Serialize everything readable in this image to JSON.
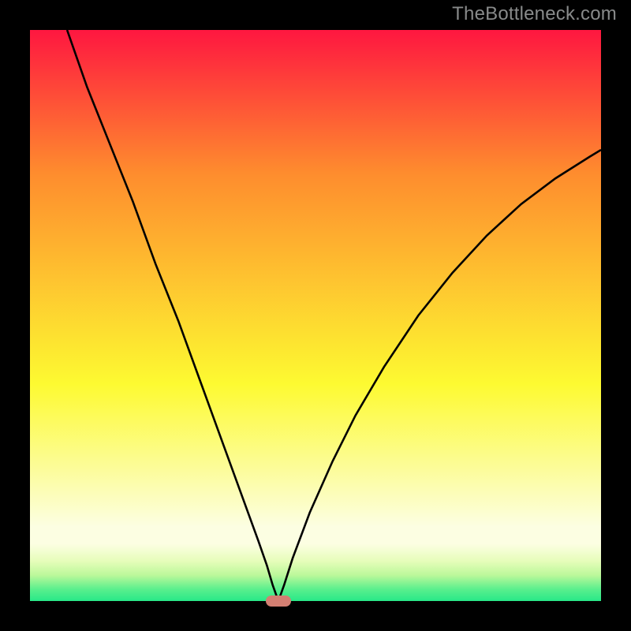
{
  "watermark": "TheBottleneck.com",
  "chart_data": {
    "type": "line",
    "title": "",
    "xlabel": "",
    "ylabel": "",
    "xlim": [
      0,
      1
    ],
    "ylim": [
      0,
      1
    ],
    "grid": false,
    "legend": false,
    "background_gradient": {
      "top": "#fe1740",
      "mid": "#fdfa31",
      "bottom": "#28e888",
      "band_colors": [
        "#fcfee2",
        "#e6fdba",
        "#bbf89a",
        "#58ef8d",
        "#28e888"
      ]
    },
    "minimum_marker": {
      "x": 0.435,
      "y": 0.0,
      "color": "#d37f72"
    },
    "series": [
      {
        "name": "bottleneck-curve",
        "color": "#000000",
        "x": [
          0.065,
          0.1,
          0.14,
          0.18,
          0.22,
          0.26,
          0.3,
          0.34,
          0.38,
          0.4,
          0.415,
          0.425,
          0.435,
          0.445,
          0.46,
          0.49,
          0.53,
          0.57,
          0.62,
          0.68,
          0.74,
          0.8,
          0.86,
          0.92,
          0.98,
          1.0
        ],
        "y": [
          1.0,
          0.9,
          0.8,
          0.7,
          0.59,
          0.49,
          0.38,
          0.27,
          0.16,
          0.105,
          0.062,
          0.028,
          0.0,
          0.028,
          0.075,
          0.155,
          0.245,
          0.325,
          0.41,
          0.5,
          0.575,
          0.64,
          0.695,
          0.74,
          0.778,
          0.79
        ]
      }
    ]
  }
}
